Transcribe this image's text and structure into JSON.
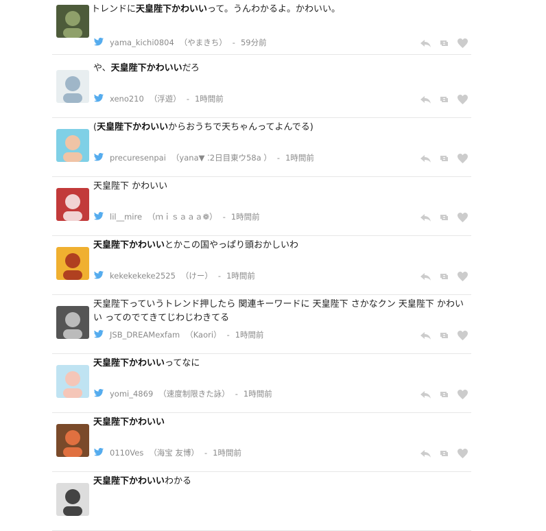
{
  "colors": {
    "twitter_blue": "#55acee",
    "meta_gray": "#8a8a8a",
    "action_gray": "#cccccc",
    "divider": "#e6e6e6"
  },
  "tweets": [
    {
      "text_before": "トレンドに",
      "highlight": "天皇陛下かわいい",
      "text_after": "って。うんわかるよ。かわいい。",
      "username": "yama_kichi0804",
      "display_name": "（やまきち）",
      "time": "59分前",
      "avatar_icon": "avatar-icon"
    },
    {
      "text_before": "や、",
      "highlight": "天皇陛下かわいい",
      "text_after": "だろ",
      "username": "xeno210",
      "display_name": "（浮遊）",
      "time": "1時間前",
      "avatar_icon": "avatar-icon"
    },
    {
      "text_before": "(",
      "highlight": "天皇陛下かわいい",
      "text_after": "からおうちで天ちゃんってよんでる)",
      "username": "precuresenpai",
      "display_name": "（yana▼ ⁚2日目東ウ58a ）",
      "time": "1時間前",
      "avatar_icon": "avatar-icon"
    },
    {
      "text_before": "天皇陛下 かわいい",
      "highlight": "",
      "text_after": "",
      "username": "lil__mire",
      "display_name": "（ｍｉｓａａａ❁）",
      "time": "1時間前",
      "avatar_icon": "avatar-icon"
    },
    {
      "text_before": "",
      "highlight": "天皇陛下かわいい",
      "text_after": "とかこの国やっぱり頭おかしいわ",
      "username": "kekekekeke2525",
      "display_name": "（けー）",
      "time": "1時間前",
      "avatar_icon": "avatar-icon"
    },
    {
      "text_before": "天皇陛下っていうトレンド押したら 関連キーワードに 天皇陛下 さかなクン 天皇陛下 かわいい ってのでてきてじわじわきてる",
      "highlight": "",
      "text_after": "",
      "username": "JSB_DREAMexfam",
      "display_name": "（Kaori）",
      "time": "1時間前",
      "avatar_icon": "avatar-icon"
    },
    {
      "text_before": "",
      "highlight": "天皇陛下かわいい",
      "text_after": "ってなに",
      "username": "yomi_4869",
      "display_name": "（速度制限きた詠）",
      "time": "1時間前",
      "avatar_icon": "avatar-icon"
    },
    {
      "text_before": "",
      "highlight": "天皇陛下かわいい",
      "text_after": "",
      "username": "0110Ves",
      "display_name": "（海宝 友博）",
      "time": "1時間前",
      "avatar_icon": "avatar-icon"
    },
    {
      "text_before": "",
      "highlight": "天皇陛下かわいい",
      "text_after": "わかる",
      "username": "",
      "display_name": "",
      "time": "",
      "avatar_icon": "avatar-icon"
    }
  ]
}
